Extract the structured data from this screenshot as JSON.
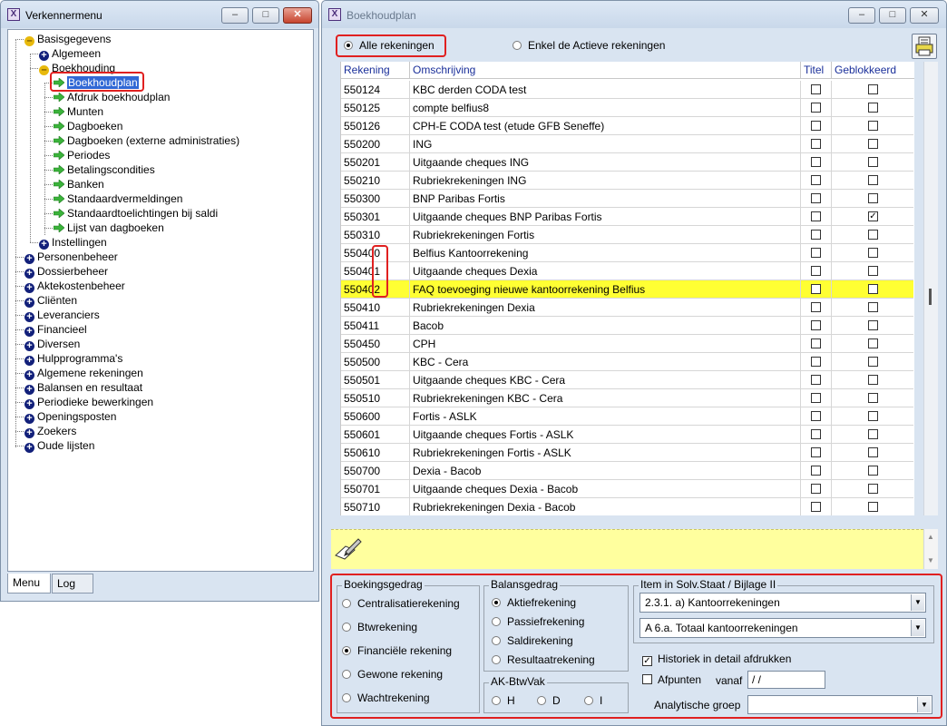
{
  "left_window": {
    "title": "Verkennermenu",
    "tree": [
      {
        "label": "Basisgegevens",
        "icon": "minus"
      },
      {
        "label": "Algemeen",
        "icon": "plus"
      },
      {
        "label": "Boekhouding",
        "icon": "minus"
      },
      {
        "label": "Boekhoudplan",
        "icon": "arrow"
      },
      {
        "label": "Afdruk boekhoudplan",
        "icon": "arrow"
      },
      {
        "label": "Munten",
        "icon": "arrow"
      },
      {
        "label": "Dagboeken",
        "icon": "arrow"
      },
      {
        "label": "Dagboeken (externe administraties)",
        "icon": "arrow"
      },
      {
        "label": "Periodes",
        "icon": "arrow"
      },
      {
        "label": "Betalingscondities",
        "icon": "arrow"
      },
      {
        "label": "Banken",
        "icon": "arrow"
      },
      {
        "label": "Standaardvermeldingen",
        "icon": "arrow"
      },
      {
        "label": "Standaardtoelichtingen bij saldi",
        "icon": "arrow"
      },
      {
        "label": "Lijst van dagboeken",
        "icon": "arrow"
      },
      {
        "label": "Instellingen",
        "icon": "plus"
      },
      {
        "label": "Personenbeheer",
        "icon": "plus"
      },
      {
        "label": "Dossierbeheer",
        "icon": "plus"
      },
      {
        "label": "Aktekostenbeheer",
        "icon": "plus"
      },
      {
        "label": "Cliënten",
        "icon": "plus"
      },
      {
        "label": "Leveranciers",
        "icon": "plus"
      },
      {
        "label": "Financieel",
        "icon": "plus"
      },
      {
        "label": "Diversen",
        "icon": "plus"
      },
      {
        "label": "Hulpprogramma's",
        "icon": "plus"
      },
      {
        "label": "Algemene rekeningen",
        "icon": "plus"
      },
      {
        "label": "Balansen en resultaat",
        "icon": "plus"
      },
      {
        "label": "Periodieke bewerkingen",
        "icon": "plus"
      },
      {
        "label": "Openingsposten",
        "icon": "plus"
      },
      {
        "label": "Zoekers",
        "icon": "plus"
      },
      {
        "label": "Oude lijsten",
        "icon": "plus"
      }
    ],
    "tabs": [
      "Menu",
      "Log"
    ]
  },
  "right_window": {
    "title": "Boekhoudplan",
    "filter": {
      "all_label": "Alle rekeningen",
      "active_label": "Enkel de Actieve rekeningen"
    },
    "columns": [
      "Rekening",
      "Omschrijving",
      "Titel",
      "Geblokkeerd"
    ],
    "rows": [
      {
        "rekening": "550124",
        "omschrijving": "KBC derden CODA test",
        "titel": false,
        "geblokkeerd": false
      },
      {
        "rekening": "550125",
        "omschrijving": "compte belfius8",
        "titel": false,
        "geblokkeerd": false
      },
      {
        "rekening": "550126",
        "omschrijving": "CPH-E CODA test (etude GFB Seneffe)",
        "titel": false,
        "geblokkeerd": false
      },
      {
        "rekening": "550200",
        "omschrijving": "ING",
        "titel": false,
        "geblokkeerd": false
      },
      {
        "rekening": "550201",
        "omschrijving": "Uitgaande cheques ING",
        "titel": false,
        "geblokkeerd": false
      },
      {
        "rekening": "550210",
        "omschrijving": "Rubriekrekeningen ING",
        "titel": false,
        "geblokkeerd": false
      },
      {
        "rekening": "550300",
        "omschrijving": "BNP Paribas Fortis",
        "titel": false,
        "geblokkeerd": false
      },
      {
        "rekening": "550301",
        "omschrijving": "Uitgaande cheques BNP Paribas Fortis",
        "titel": false,
        "geblokkeerd": true
      },
      {
        "rekening": "550310",
        "omschrijving": "Rubriekrekeningen Fortis",
        "titel": false,
        "geblokkeerd": false
      },
      {
        "rekening": "550400",
        "omschrijving": "Belfius Kantoorrekening",
        "titel": false,
        "geblokkeerd": false
      },
      {
        "rekening": "550401",
        "omschrijving": "Uitgaande cheques Dexia",
        "titel": false,
        "geblokkeerd": false
      },
      {
        "rekening": "550402",
        "omschrijving": "FAQ toevoeging nieuwe kantoorrekening Belfius",
        "titel": false,
        "geblokkeerd": false,
        "selected": true
      },
      {
        "rekening": "550410",
        "omschrijving": "Rubriekrekeningen Dexia",
        "titel": false,
        "geblokkeerd": false
      },
      {
        "rekening": "550411",
        "omschrijving": "Bacob",
        "titel": false,
        "geblokkeerd": false
      },
      {
        "rekening": "550450",
        "omschrijving": "CPH",
        "titel": false,
        "geblokkeerd": false
      },
      {
        "rekening": "550500",
        "omschrijving": "KBC - Cera",
        "titel": false,
        "geblokkeerd": false
      },
      {
        "rekening": "550501",
        "omschrijving": "Uitgaande cheques KBC - Cera",
        "titel": false,
        "geblokkeerd": false
      },
      {
        "rekening": "550510",
        "omschrijving": "Rubriekrekeningen KBC - Cera",
        "titel": false,
        "geblokkeerd": false
      },
      {
        "rekening": "550600",
        "omschrijving": "Fortis - ASLK",
        "titel": false,
        "geblokkeerd": false
      },
      {
        "rekening": "550601",
        "omschrijving": "Uitgaande cheques Fortis - ASLK",
        "titel": false,
        "geblokkeerd": false
      },
      {
        "rekening": "550610",
        "omschrijving": "Rubriekrekeningen Fortis - ASLK",
        "titel": false,
        "geblokkeerd": false
      },
      {
        "rekening": "550700",
        "omschrijving": "Dexia - Bacob",
        "titel": false,
        "geblokkeerd": false
      },
      {
        "rekening": "550701",
        "omschrijving": "Uitgaande cheques Dexia - Bacob",
        "titel": false,
        "geblokkeerd": false
      },
      {
        "rekening": "550710",
        "omschrijving": "Rubriekrekeningen Dexia - Bacob",
        "titel": false,
        "geblokkeerd": false
      }
    ],
    "boekingsgedrag": {
      "legend": "Boekingsgedrag",
      "options": [
        "Centralisatierekening",
        "Btwrekening",
        "Financiële rekening",
        "Gewone rekening",
        "Wachtrekening"
      ],
      "selected": 2
    },
    "balansgedrag": {
      "legend": "Balansgedrag",
      "options": [
        "Aktiefrekening",
        "Passiefrekening",
        "Saldirekening",
        "Resultaatrekening"
      ],
      "selected": 0
    },
    "ak_btwvak": {
      "legend": "AK-BtwVak",
      "options": [
        "H",
        "D",
        "I"
      ]
    },
    "solv": {
      "legend": "Item in Solv.Staat / Bijlage II",
      "select1": "2.3.1. a) Kantoorrekeningen",
      "select2": "A 6.a. Totaal kantoorrekeningen"
    },
    "historiek_label": "Historiek in detail afdrukken",
    "historiek_checked": true,
    "afpunten_label": "Afpunten",
    "vanaf_label": "vanaf",
    "vanaf_value": " /  /",
    "analytische_label": "Analytische groep",
    "analytische_value": ""
  }
}
